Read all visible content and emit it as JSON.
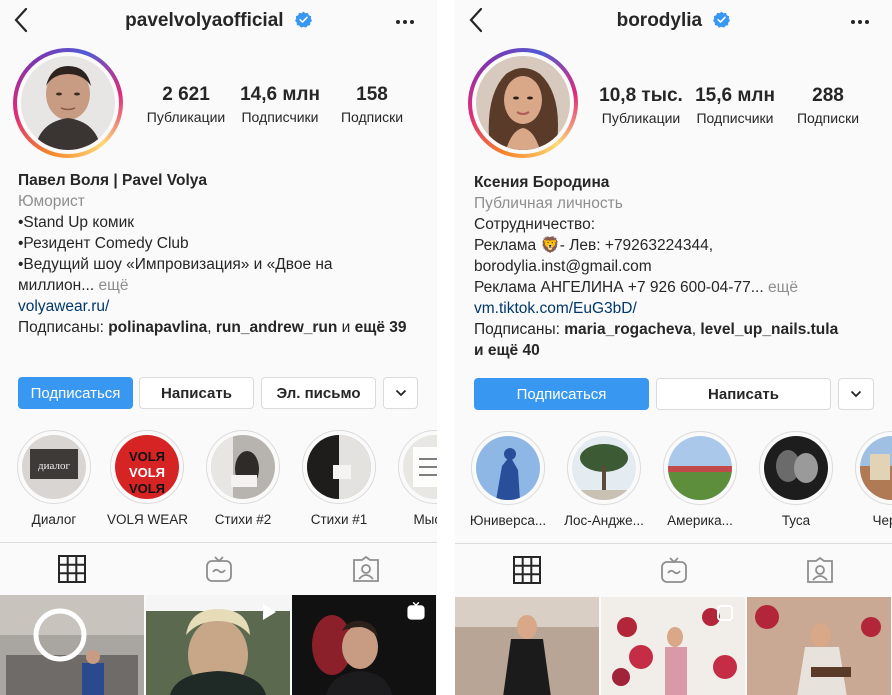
{
  "left": {
    "username": "pavelvolyaofficial",
    "stats": [
      {
        "value": "2 621",
        "label": "Публикации"
      },
      {
        "value": "14,6 млн",
        "label": "Подписчики"
      },
      {
        "value": "158",
        "label": "Подписки"
      }
    ],
    "bio": {
      "name": "Павел Воля | Pavel Volya",
      "category": "Юморист",
      "lines": [
        "•Stand Up комик",
        "•Резидент Comedy Club",
        "•Ведущий шоу «Импровизация» и «Двое на"
      ],
      "truncated": "миллион...",
      "more": " ещё",
      "link": "volyawear.ru/",
      "followed_prefix": "Подписаны: ",
      "followed_1": "polinapavlina",
      "followed_sep": ", ",
      "followed_2": "run_andrew_run",
      "followed_and": " и ",
      "followed_more": "ещё 39"
    },
    "buttons": {
      "follow": "Подписаться",
      "message": "Написать",
      "email": "Эл. письмо"
    },
    "highlights": [
      "Диалог",
      "VOLЯ WEAR",
      "Стихи #2",
      "Стихи #1",
      "Мысли"
    ]
  },
  "right": {
    "username": "borodylia",
    "stats": [
      {
        "value": "10,8 тыс.",
        "label": "Публикации"
      },
      {
        "value": "15,6 млн",
        "label": "Подписчики"
      },
      {
        "value": "288",
        "label": "Подписки"
      }
    ],
    "bio": {
      "name": "Ксения Бородина",
      "category": "Публичная личность",
      "line1": "Сотрудничество:",
      "line2": "Реклама 🦁- Лев: +79263224344,",
      "line3": "borodylia.inst@gmail.com",
      "line4": "Реклама АНГЕЛИНА +7 926 600-04-77...",
      "more": " ещё",
      "link": "vm.tiktok.com/EuG3bD/",
      "followed_prefix": "Подписаны: ",
      "followed_1": "maria_rogacheva",
      "followed_sep": ", ",
      "followed_2": "level_up_nails.tula",
      "followed_more": "и ещё 40"
    },
    "buttons": {
      "follow": "Подписаться",
      "message": "Написать"
    },
    "highlights": [
      "Юниверса...",
      "Лос-Андже...",
      "Америка...",
      "Туса",
      "Черна"
    ]
  },
  "colors": {
    "primary": "#3897f0",
    "verified": "#3897f0",
    "link": "#00376b",
    "muted": "#8e8e8e"
  },
  "icons": [
    "back-arrow-icon",
    "verified-badge-icon",
    "more-options-icon",
    "chevron-down-icon",
    "grid-icon",
    "igtv-icon",
    "tagged-icon",
    "video-icon",
    "igtv-badge-icon"
  ]
}
